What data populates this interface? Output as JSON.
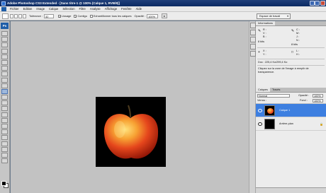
{
  "window": {
    "title": "Adobe Photoshop CS3 Extended - [Sans titre-1 @ 100% (Calque 1, RVB/8)]"
  },
  "menu": {
    "items": [
      "Fichier",
      "Edition",
      "Image",
      "Calque",
      "Sélection",
      "Filtre",
      "Analyse",
      "Affichage",
      "Fenêtre",
      "Aide"
    ]
  },
  "options": {
    "tolerance_label": "Tolérance :",
    "tolerance_value": "32",
    "lisse_label": "Lissage",
    "contig_label": "Contigu",
    "echant_label": "Echantillonner tous les calques",
    "opacity_label": "Opacité :",
    "opacity_value": "100%",
    "workspace_label": "Espace de travail"
  },
  "tools": {
    "logo": "Ps"
  },
  "info_panel": {
    "tabs": [
      "Informations"
    ],
    "r_label": "R :",
    "v_label": "V :",
    "b_label": "B :",
    "bits1": "8 bits",
    "c_label": "C :",
    "m_label": "M :",
    "j_label": "J :",
    "n_label": "N :",
    "bits2": "8 bits",
    "x_label": "X :",
    "y_label": "Y :",
    "w_label": "L :",
    "h_label": "H :",
    "doc_info": "Doc : 225,4 Ko/299,4 Ko",
    "hint": "Cliquez sur la zone de l'image à remplir de transparence."
  },
  "layers_panel": {
    "tabs": [
      "Calques",
      "Tracés"
    ],
    "blend_mode": "Normal",
    "opacity_label": "Opacité :",
    "opacity_value": "100%",
    "lock_label": "Verrou :",
    "fill_label": "Fond :",
    "fill_value": "100%",
    "layers": [
      {
        "name": "Calque 1",
        "selected": true
      },
      {
        "name": "Arrière-plan",
        "selected": false
      }
    ]
  }
}
